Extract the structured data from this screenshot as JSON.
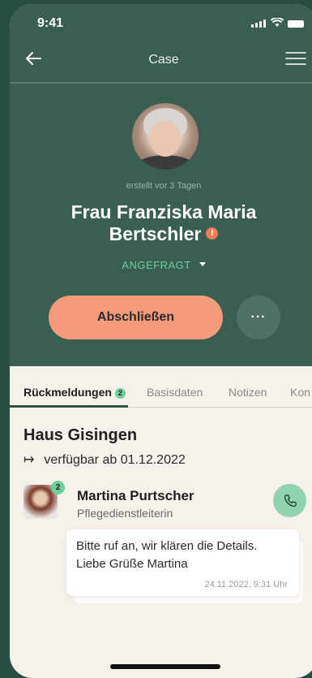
{
  "status_bar": {
    "time": "9:41"
  },
  "header": {
    "title": "Case"
  },
  "profile": {
    "created": "erstellt vor 3 Tagen",
    "name": "Frau Franziska Maria Bertschler",
    "warning_badge": "!",
    "status": "ANGEFRAGT"
  },
  "actions": {
    "primary": "Abschließen",
    "more": "···"
  },
  "tabs": [
    {
      "label": "Rückmeldungen",
      "badge": "2",
      "active": true
    },
    {
      "label": "Basisdaten"
    },
    {
      "label": "Notizen"
    },
    {
      "label": "Kon"
    }
  ],
  "feedback": {
    "place": "Haus Gisingen",
    "availability": "verfügbar ab 01.12.2022",
    "message": {
      "badge": "2",
      "sender": "Martina Purtscher",
      "role": "Pflegedienstleiterin",
      "text_line1": "Bitte ruf an, wir klären die Details.",
      "text_line2": "Liebe Grüße Martina",
      "timestamp": "24.11.2022, 9:31 Uhr"
    }
  },
  "colors": {
    "header_bg": "#3a5f52",
    "accent_button": "#f39b7a",
    "status_green": "#6ecb9c",
    "badge_green": "#6fcf9a",
    "content_bg": "#f7f1ec"
  }
}
